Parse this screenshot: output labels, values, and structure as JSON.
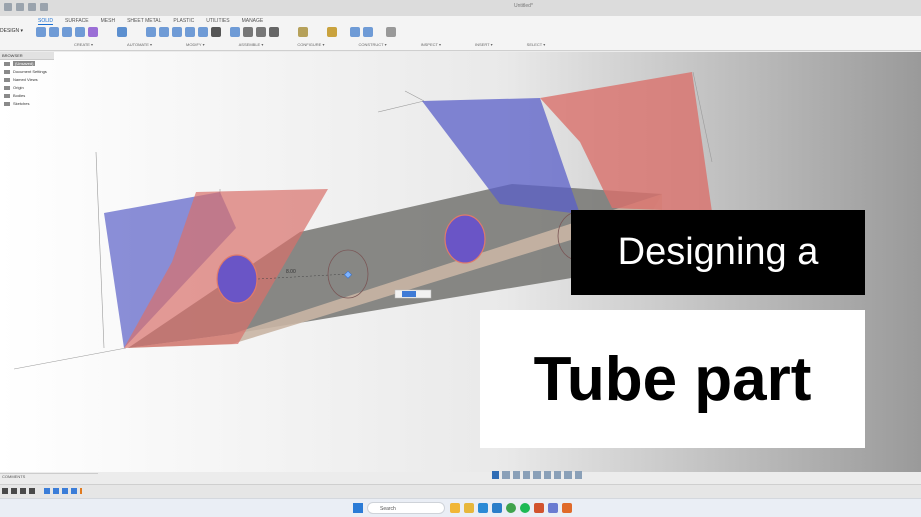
{
  "app": {
    "document_title": "Untitled*",
    "workspace": "DESIGN ▾"
  },
  "ribbon": {
    "tabs": [
      "SOLID",
      "SURFACE",
      "MESH",
      "SHEET METAL",
      "PLASTIC",
      "UTILITIES",
      "MANAGE"
    ],
    "active_tab": "SOLID",
    "groups": [
      "CREATE ▾",
      "AUTOMATE ▾",
      "MODIFY ▾",
      "ASSEMBLE ▾",
      "CONFIGURE ▾",
      "CONSTRUCT ▾",
      "INSPECT ▾",
      "INSERT ▾",
      "SELECT ▾"
    ]
  },
  "browser": {
    "title": "BROWSER",
    "items": [
      "(Unsaved)",
      "Document Settings",
      "Named Views",
      "Origin",
      "Bodies",
      "Sketches"
    ]
  },
  "viewport": {
    "dimension_label": "8.00",
    "colors": {
      "profile_blue": "#5a5fc8",
      "profile_red": "#d9706b",
      "hole_fill": "#6a55c6",
      "tube_face": "#6d6d6b"
    }
  },
  "overlay": {
    "line1": "Designing a",
    "line2": "Tube part"
  },
  "comments": {
    "title": "COMMENTS"
  },
  "taskbar": {
    "search_placeholder": "Search"
  }
}
